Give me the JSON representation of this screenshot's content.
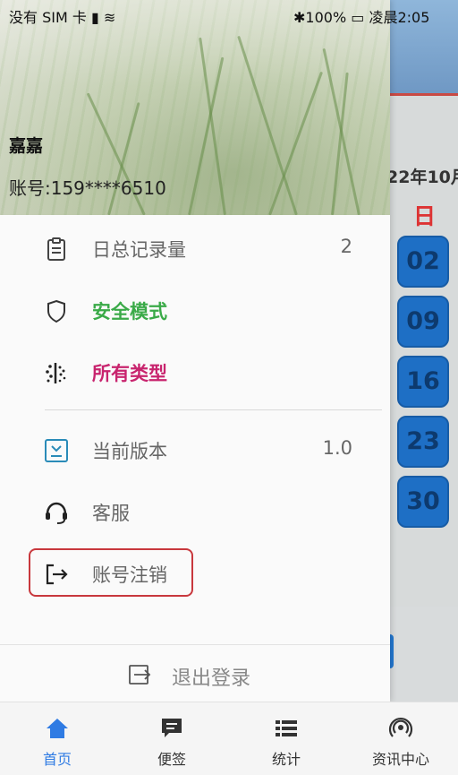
{
  "status_bar": {
    "left": "没有 SIM 卡",
    "battery": "100%",
    "time": "凌晨2:05"
  },
  "background_app": {
    "year_month": "22年10月",
    "weekday": "日",
    "days": [
      "02",
      "09",
      "16",
      "23",
      "30"
    ]
  },
  "drawer": {
    "user_name": "嘉嘉",
    "account": "账号:159****6510",
    "items": [
      {
        "label": "日总记录量",
        "value": "2",
        "icon": "clipboard-icon",
        "color": "#666666"
      },
      {
        "label": "安全模式",
        "icon": "shield-icon",
        "color": "#3aaa48"
      },
      {
        "label": "所有类型",
        "icon": "scatter-icon",
        "color": "#c8246e"
      },
      {
        "label": "当前版本",
        "value": "1.0",
        "icon": "download-box-icon",
        "color": "#666666"
      },
      {
        "label": "客服",
        "icon": "headset-icon",
        "color": "#666666"
      },
      {
        "label": "账号注销",
        "icon": "logout-arrow-icon",
        "color": "#666666"
      }
    ],
    "logout_label": "退出登录"
  },
  "bottom_nav": {
    "tabs": [
      {
        "label": "首页",
        "icon": "home-icon",
        "active": true
      },
      {
        "label": "便签",
        "icon": "note-icon"
      },
      {
        "label": "统计",
        "icon": "list-icon"
      },
      {
        "label": "资讯中心",
        "icon": "broadcast-icon"
      }
    ],
    "active_color": "#2f7be3"
  }
}
